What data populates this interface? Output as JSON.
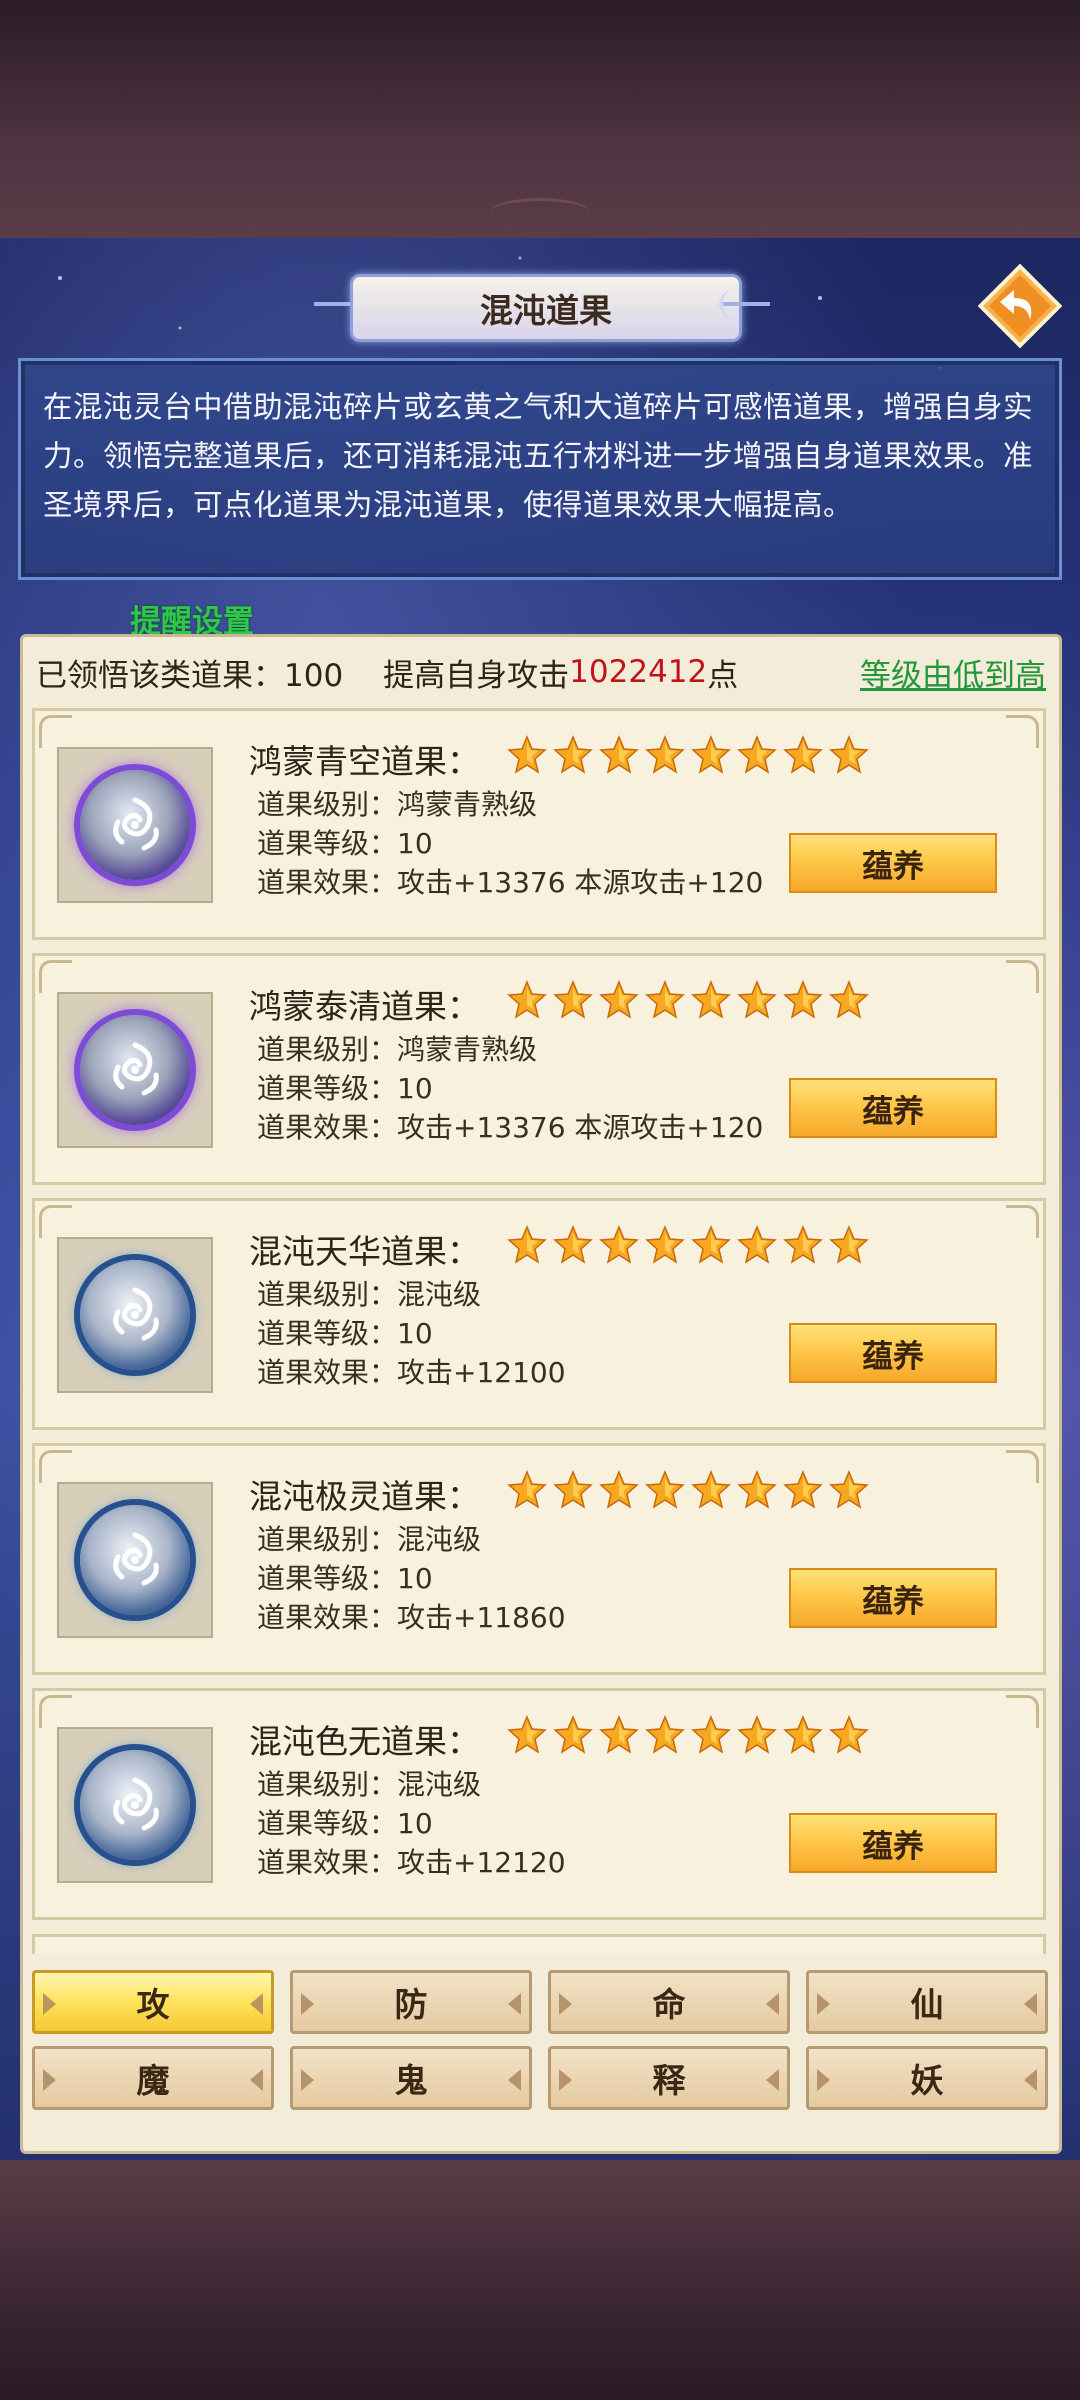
{
  "header": {
    "title": "混沌道果"
  },
  "description": "在混沌灵台中借助混沌碎片或玄黄之气和大道碎片可感悟道果，增强自身实力。领悟完整道果后，还可消耗混沌五行材料进一步增强自身道果效果。准圣境界后，可点化道果为混沌道果，使得道果效果大幅提高。",
  "reminder_label": "提醒设置",
  "summary": {
    "count_text": "已领悟该类道果：100",
    "boost_prefix": "提高自身攻击",
    "boost_value": "1022412",
    "boost_suffix": "点",
    "sort_label": "等级由低到高"
  },
  "cards": [
    {
      "name": "鸿蒙青空道果：",
      "stars": 8,
      "orb": "purple",
      "level_name": "道果级别：鸿蒙青熟级",
      "level": "道果等级：10",
      "effect": "道果效果：攻击+13376  本源攻击+120",
      "button": "蕴养"
    },
    {
      "name": "鸿蒙泰清道果：",
      "stars": 8,
      "orb": "purple",
      "level_name": "道果级别：鸿蒙青熟级",
      "level": "道果等级：10",
      "effect": "道果效果：攻击+13376  本源攻击+120",
      "button": "蕴养"
    },
    {
      "name": "混沌天华道果：",
      "stars": 8,
      "orb": "blue",
      "level_name": "道果级别：混沌级",
      "level": "道果等级：10",
      "effect": "道果效果：攻击+12100",
      "button": "蕴养"
    },
    {
      "name": "混沌极灵道果：",
      "stars": 8,
      "orb": "blue",
      "level_name": "道果级别：混沌级",
      "level": "道果等级：10",
      "effect": "道果效果：攻击+11860",
      "button": "蕴养"
    },
    {
      "name": "混沌色无道果：",
      "stars": 8,
      "orb": "blue",
      "level_name": "道果级别：混沌级",
      "level": "道果等级：10",
      "effect": "道果效果：攻击+12120",
      "button": "蕴养"
    }
  ],
  "tabs": [
    {
      "label": "攻",
      "active": true
    },
    {
      "label": "防",
      "active": false
    },
    {
      "label": "命",
      "active": false
    },
    {
      "label": "仙",
      "active": false
    },
    {
      "label": "魔",
      "active": false
    },
    {
      "label": "鬼",
      "active": false
    },
    {
      "label": "释",
      "active": false
    },
    {
      "label": "妖",
      "active": false
    }
  ],
  "colors": {
    "accent_red": "#c0141a",
    "accent_green": "#22983a",
    "active_tab": "#ffe25c"
  },
  "icons": {
    "back": "back-arrow-icon",
    "star": "star-icon",
    "orb": "taiji-cloud-orb-icon"
  }
}
